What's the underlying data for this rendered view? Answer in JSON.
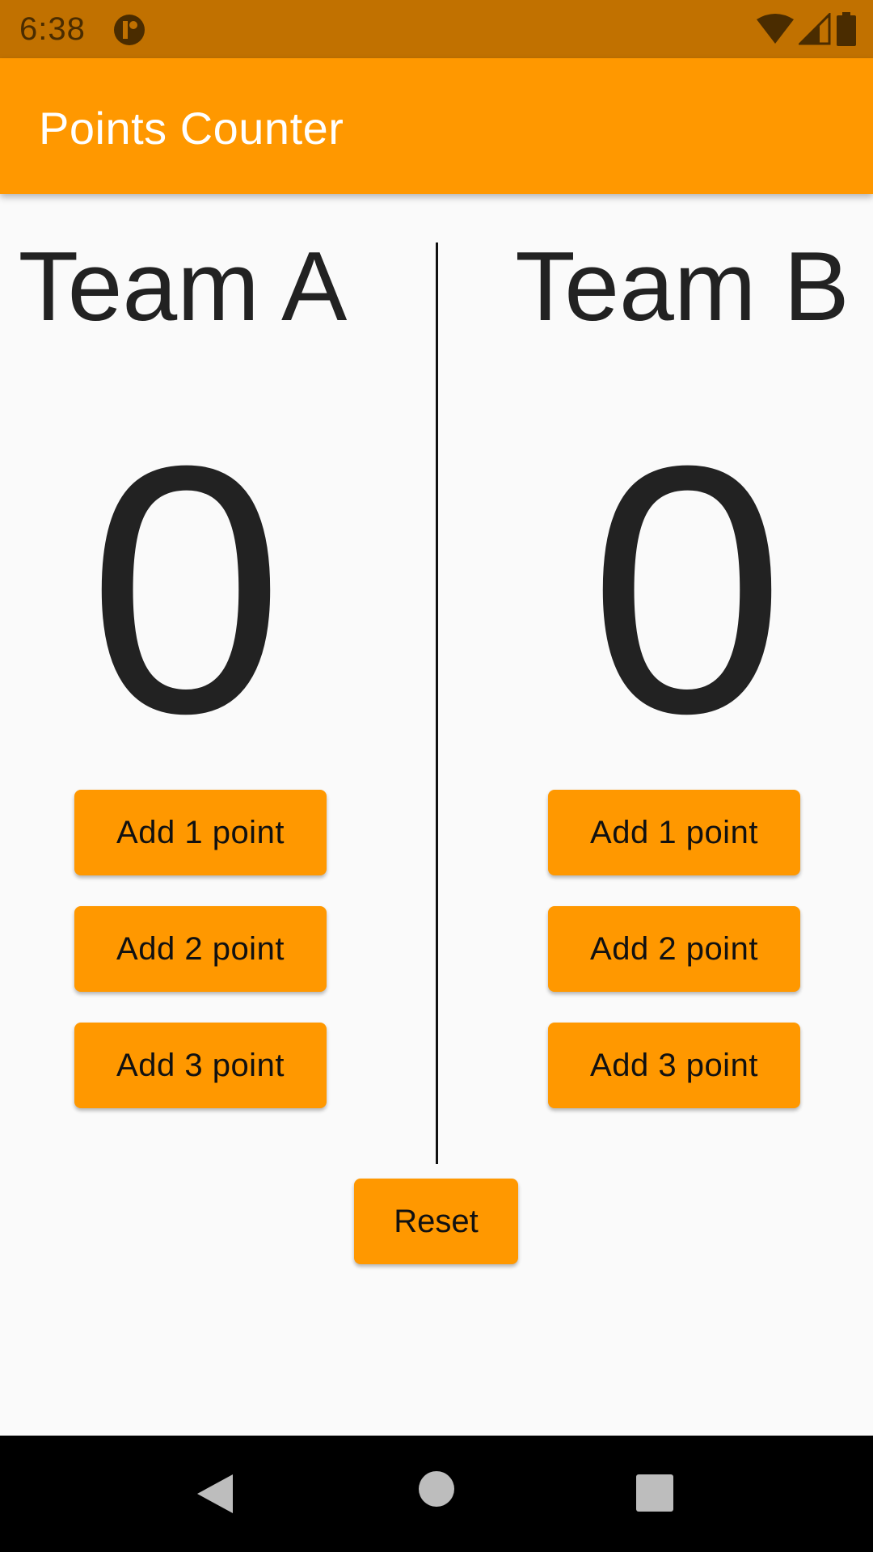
{
  "status_bar": {
    "time": "6:38",
    "icons": [
      "notification-icon",
      "wifi-icon",
      "signal-icon",
      "battery-icon"
    ]
  },
  "app_bar": {
    "title": "Points Counter"
  },
  "team_a": {
    "name": "Team A",
    "score": "0",
    "buttons": [
      "Add 1 point",
      "Add 2 point",
      "Add 3 point"
    ]
  },
  "team_b": {
    "name": "Team B",
    "score": "0",
    "buttons": [
      "Add 1 point",
      "Add 2 point",
      "Add 3 point"
    ]
  },
  "reset_label": "Reset",
  "nav": {
    "icons": [
      "back-icon",
      "home-icon",
      "recents-icon"
    ]
  },
  "colors": {
    "status_bar": "#c17100",
    "app_bar": "#ff9800",
    "button": "#ff9800",
    "background": "#fafafa",
    "text": "#222222"
  }
}
